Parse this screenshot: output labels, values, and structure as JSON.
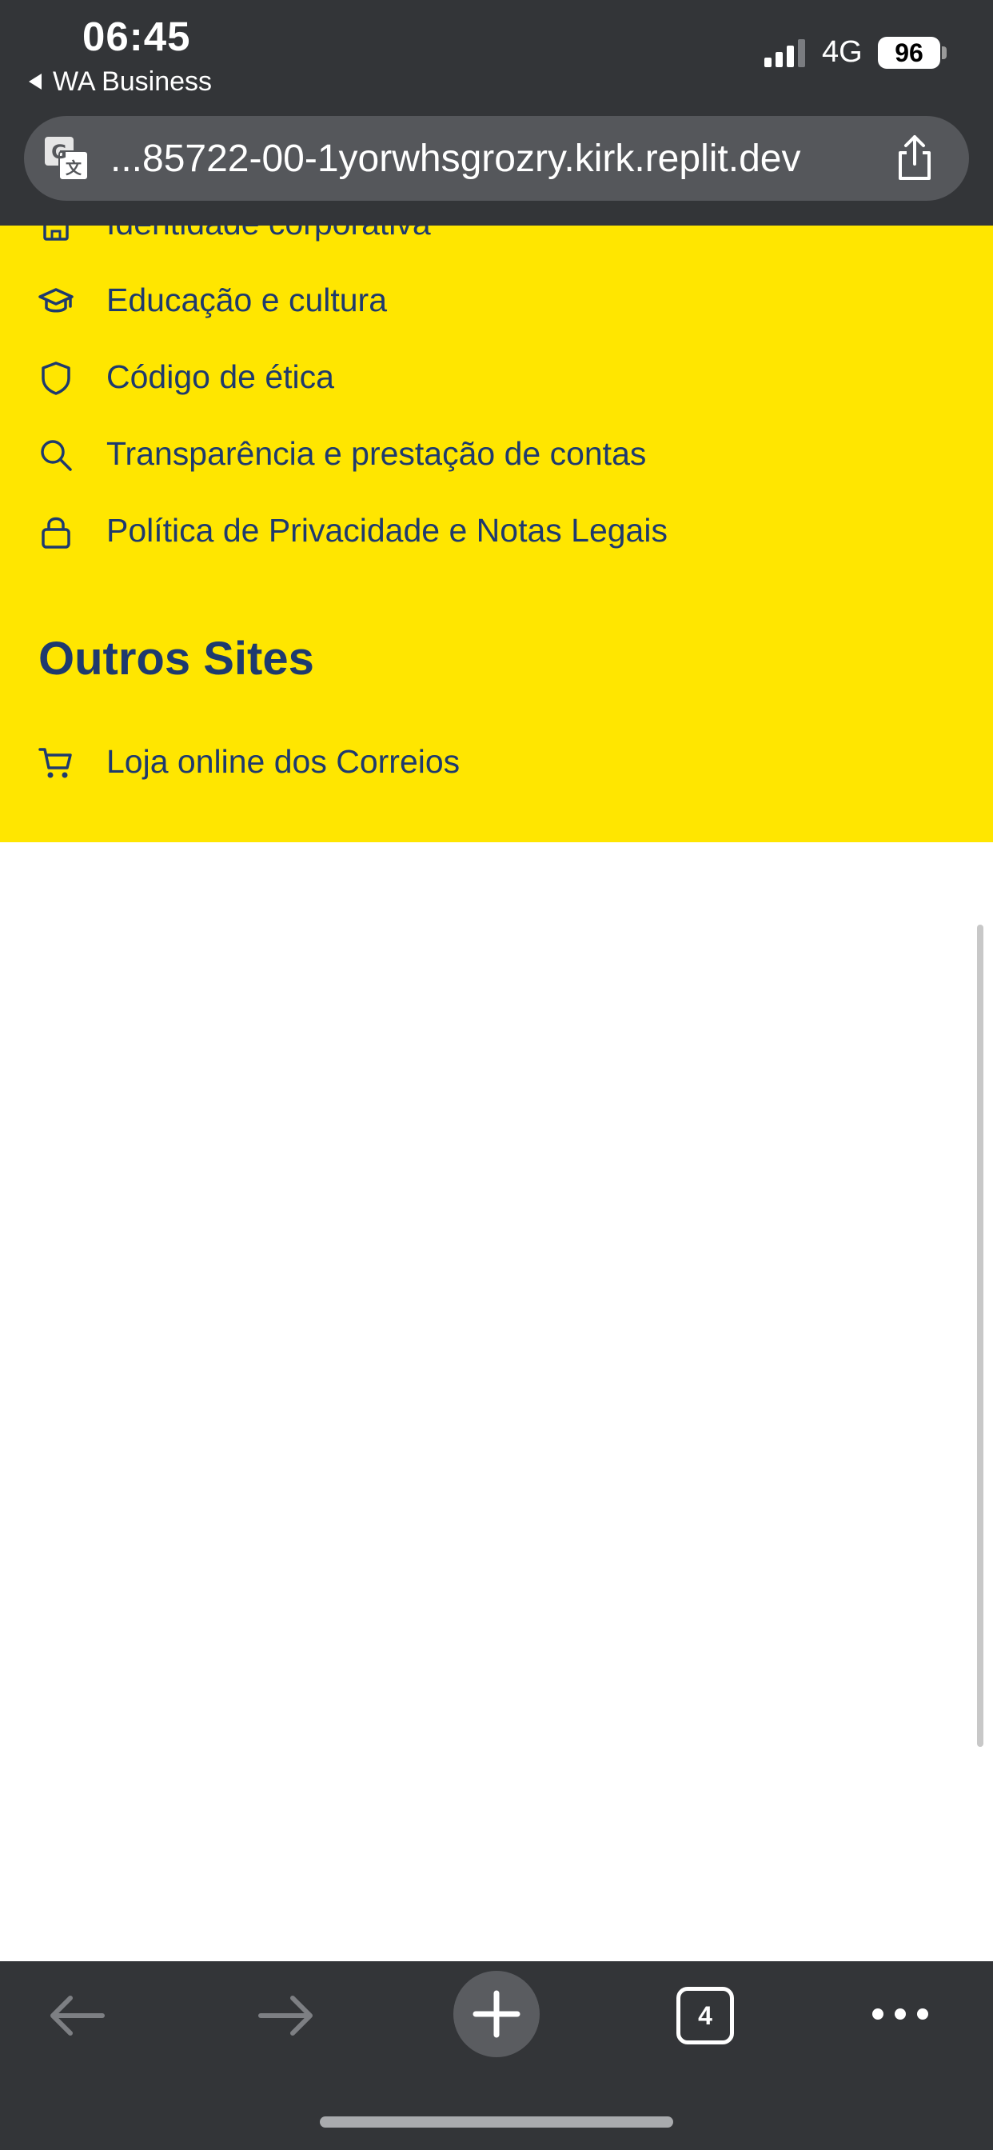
{
  "status_bar": {
    "time": "06:45",
    "back_app": "WA Business",
    "network": "4G",
    "battery": "96"
  },
  "browser": {
    "url": "...85722-00-1yorwhsgrozry.kirk.replit.dev",
    "open_tabs": "4"
  },
  "links": [
    {
      "label": "Identidade corporativa",
      "icon": "building-icon"
    },
    {
      "label": "Educação e cultura",
      "icon": "graduation-cap-icon"
    },
    {
      "label": "Código de ética",
      "icon": "shield-icon"
    },
    {
      "label": "Transparência e prestação de contas",
      "icon": "search-icon"
    },
    {
      "label": "Política de Privacidade e Notas Legais",
      "icon": "lock-icon"
    }
  ],
  "other_sites": {
    "title": "Outros Sites",
    "items": [
      {
        "label": "Loja online dos Correios",
        "icon": "cart-icon"
      }
    ]
  },
  "colors": {
    "footer_bg": "#ffe600",
    "link_text": "#1e3a6e",
    "chrome_bg": "#333538"
  }
}
